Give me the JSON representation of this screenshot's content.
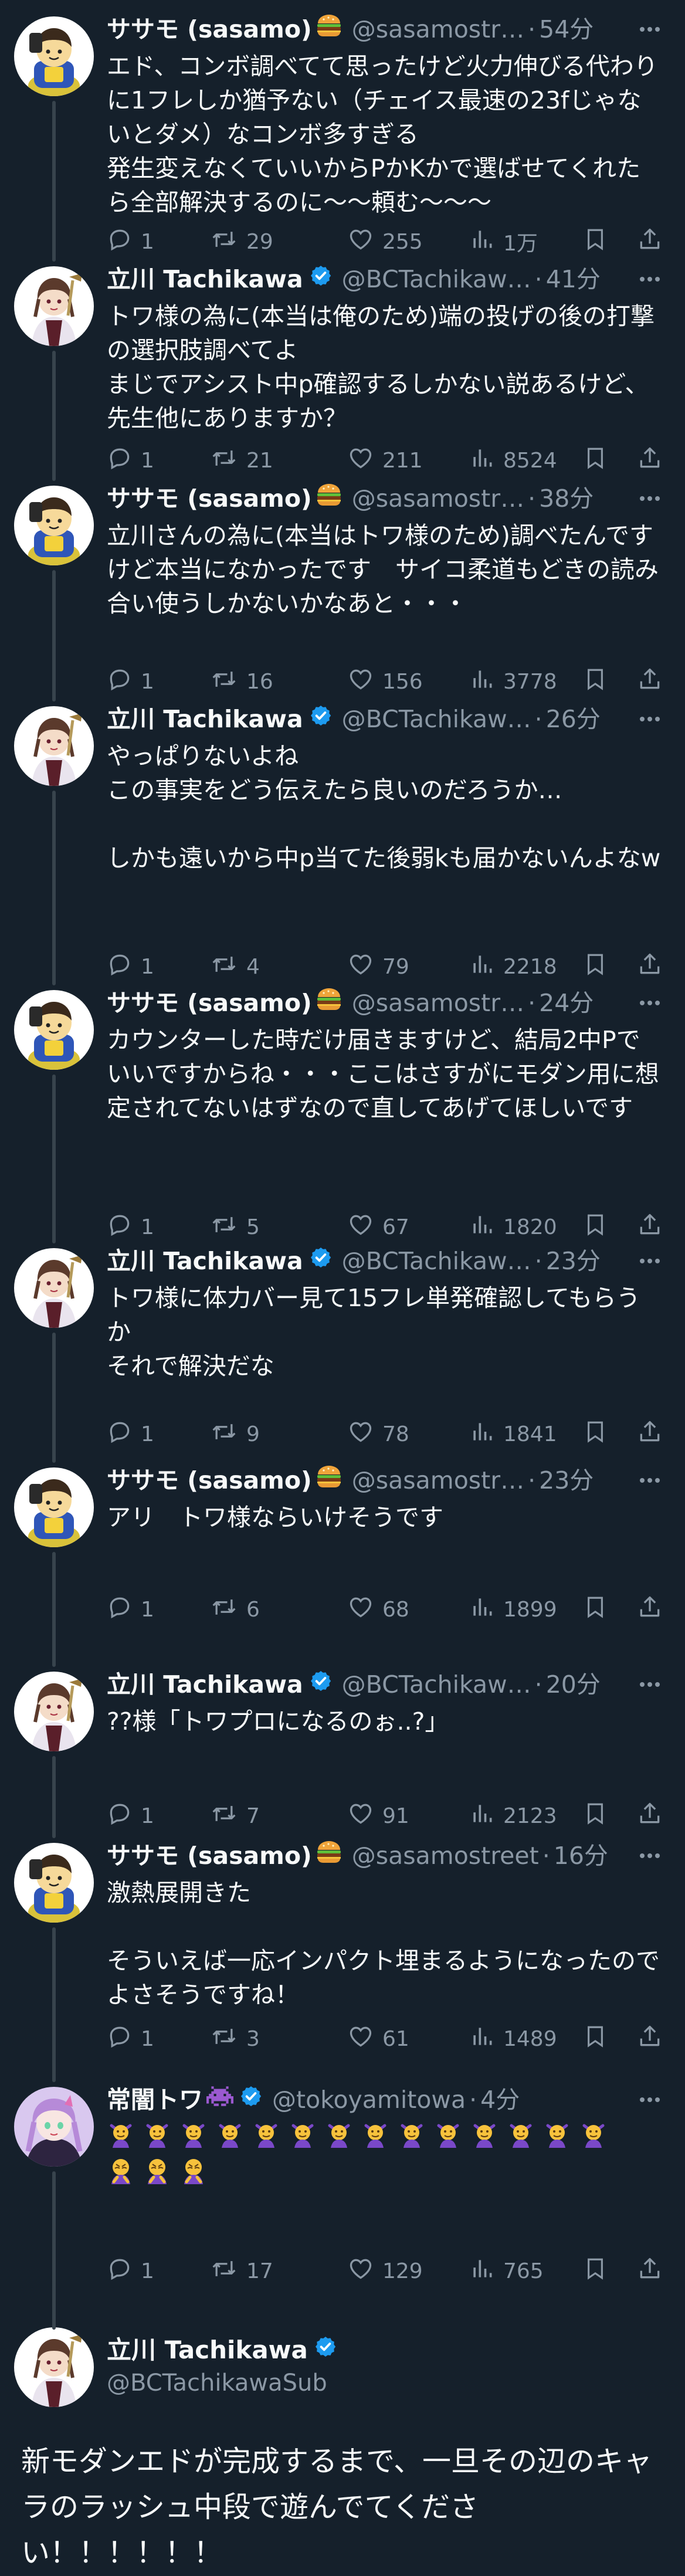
{
  "tweets": [
    {
      "author": "sasamo",
      "name": "ササモ (sasamo)",
      "handle": "@sasamostr…",
      "time": "54分",
      "text": "エド、コンボ調べてて思ったけど火力伸びる代わりに1フレしか猶予ない（チェイス最速の23fじゃないとダメ）なコンボ多すぎる\n発生変えなくていいからPかKかで選ばせてくれたら全部解決するのに〜〜頼む〜〜〜",
      "replies": "1",
      "retweets": "29",
      "likes": "255",
      "views": "1万"
    },
    {
      "author": "tachikawa",
      "name": "立川 Tachikawa",
      "handle": "@BCTachikaw…",
      "time": "41分",
      "text": "トワ様の為に(本当は俺のため)端の投げの後の打撃の選択肢調べてよ\nまじでアシスト中p確認するしかない説あるけど、先生他にありますか？",
      "replies": "1",
      "retweets": "21",
      "likes": "211",
      "views": "8524"
    },
    {
      "author": "sasamo",
      "name": "ササモ (sasamo)",
      "handle": "@sasamostr…",
      "time": "38分",
      "text": "立川さんの為に(本当はトワ様のため)調べたんですけど本当になかったです　サイコ柔道もどきの読み合い使うしかないかなあと・・・",
      "replies": "1",
      "retweets": "16",
      "likes": "156",
      "views": "3778"
    },
    {
      "author": "tachikawa",
      "name": "立川 Tachikawa",
      "handle": "@BCTachikaw…",
      "time": "26分",
      "text": "やっぱりないよね\nこの事実をどう伝えたら良いのだろうか…\n\nしかも遠いから中p当てた後弱kも届かないんよなw",
      "replies": "1",
      "retweets": "4",
      "likes": "79",
      "views": "2218"
    },
    {
      "author": "sasamo",
      "name": "ササモ (sasamo)",
      "handle": "@sasamostr…",
      "time": "24分",
      "text": "カウンターした時だけ届きますけど、結局2中Pでいいですからね・・・ここはさすがにモダン用に想定されてないはずなので直してあげてほしいです",
      "replies": "1",
      "retweets": "5",
      "likes": "67",
      "views": "1820"
    },
    {
      "author": "tachikawa",
      "name": "立川 Tachikawa",
      "handle": "@BCTachikaw…",
      "time": "23分",
      "text": "トワ様に体力バー見て15フレ単発確認してもらうか\nそれで解決だな",
      "replies": "1",
      "retweets": "9",
      "likes": "78",
      "views": "1841"
    },
    {
      "author": "sasamo",
      "name": "ササモ (sasamo)",
      "handle": "@sasamostr…",
      "time": "23分",
      "text": "アリ　トワ様ならいけそうです",
      "replies": "1",
      "retweets": "6",
      "likes": "68",
      "views": "1899"
    },
    {
      "author": "tachikawa",
      "name": "立川 Tachikawa",
      "handle": "@BCTachikaw…",
      "time": "20分",
      "text": "??様「トワプロになるのぉ..?」",
      "replies": "1",
      "retweets": "7",
      "likes": "91",
      "views": "2123"
    },
    {
      "author": "sasamo",
      "name": "ササモ (sasamo)",
      "handle": "@sasamostreet",
      "time": "16分",
      "text": "激熱展開きた\n\nそういえば一応インパクト埋まるようになったのでよさそうですね！",
      "replies": "1",
      "retweets": "3",
      "likes": "61",
      "views": "1489"
    },
    {
      "author": "towa",
      "name": "常闇トワ",
      "handle": "@tokoyamitowa",
      "time": "4分",
      "text": "",
      "emoji_first": 7,
      "emoji_second": 14,
      "emoji_total": 17,
      "replies": "1",
      "retweets": "17",
      "likes": "129",
      "views": "765"
    }
  ],
  "main_tweet": {
    "name": "立川 Tachikawa",
    "handle": "@BCTachikawaSub",
    "text": "新モダンエドが完成するまで、一旦その辺のキャラのラッシュ中段で遊んでてください！！！！！！"
  },
  "colors": {
    "background": "#15202b",
    "text": "#f7f9f9",
    "muted": "#8b98a5",
    "verified": "#1d9bf0",
    "thread_line": "#38444d"
  },
  "icons": [
    "reply-icon",
    "retweet-icon",
    "like-icon",
    "views-icon",
    "bookmark-icon",
    "share-icon",
    "more-icon",
    "verified-icon",
    "burger-emoji",
    "invader-emoji"
  ]
}
